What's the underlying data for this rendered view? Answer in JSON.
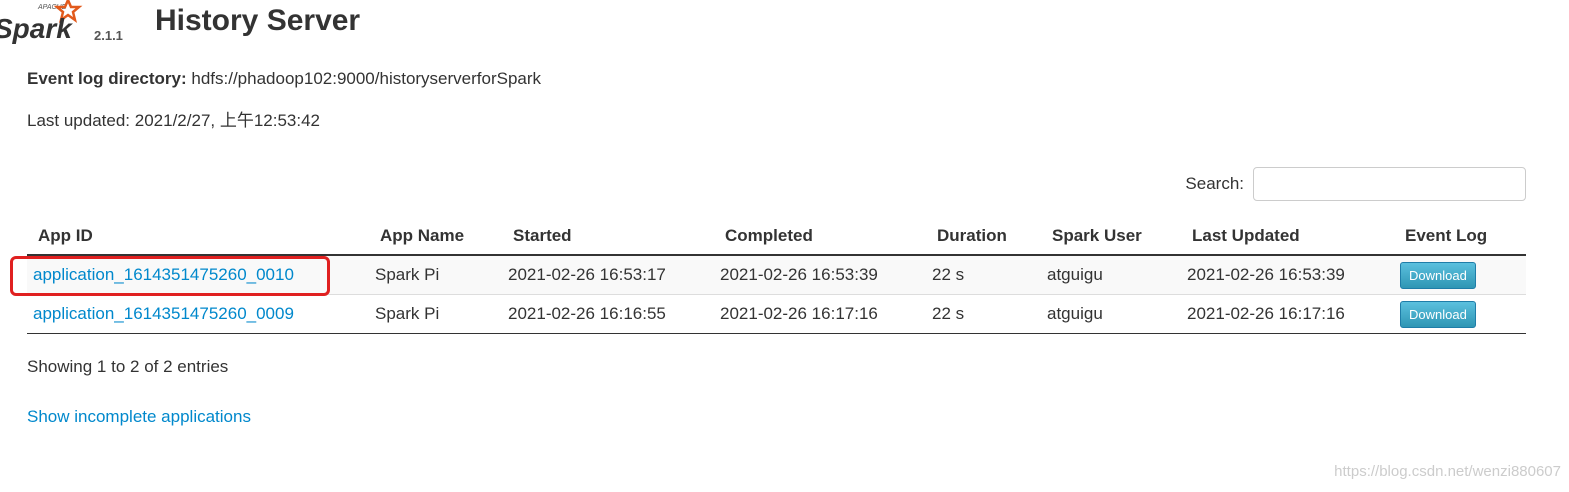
{
  "logo": {
    "apache_text": "APACHE",
    "spark_text": "Spark",
    "version": "2.1.1"
  },
  "header": {
    "title": "History Server"
  },
  "info": {
    "event_log_label": "Event log directory:",
    "event_log_value": "hdfs://phadoop102:9000/historyserverforSpark",
    "last_updated_label": "Last updated:",
    "last_updated_value": "2021/2/27, 上午12:53:42"
  },
  "search": {
    "label": "Search:",
    "value": ""
  },
  "table": {
    "headers": [
      "App ID",
      "App Name",
      "Started",
      "Completed",
      "Duration",
      "Spark User",
      "Last Updated",
      "Event Log"
    ],
    "rows": [
      {
        "app_id": "application_1614351475260_0010",
        "app_name": "Spark Pi",
        "started": "2021-02-26 16:53:17",
        "completed": "2021-02-26 16:53:39",
        "duration": "22 s",
        "spark_user": "atguigu",
        "last_updated": "2021-02-26 16:53:39",
        "event_log": "Download"
      },
      {
        "app_id": "application_1614351475260_0009",
        "app_name": "Spark Pi",
        "started": "2021-02-26 16:16:55",
        "completed": "2021-02-26 16:17:16",
        "duration": "22 s",
        "spark_user": "atguigu",
        "last_updated": "2021-02-26 16:17:16",
        "event_log": "Download"
      }
    ]
  },
  "footer": {
    "showing": "Showing 1 to 2 of 2 entries",
    "incomplete_link": "Show incomplete applications"
  },
  "watermark": "https://blog.csdn.net/wenzi880607",
  "colors": {
    "link": "#0088cc",
    "spark_orange": "#e25a1c",
    "highlight": "#e02020"
  }
}
